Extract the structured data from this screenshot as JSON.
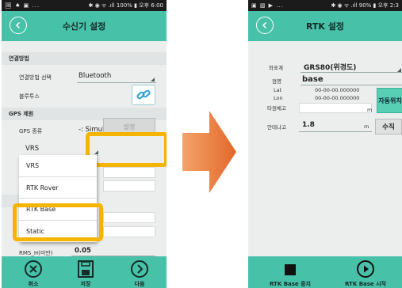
{
  "left": {
    "status": {
      "left_icons": "🖼 ♠ ▣ ...",
      "right": "✱ ◉ ᯤ .ıll 100% ▮ 오후 6:00"
    },
    "title": "수신기 설정",
    "sections": {
      "connection": "연결방법",
      "gps": "GPS 제원"
    },
    "rows": {
      "connection_method_label": "연결방법 선택",
      "connection_method_value": "Bluetooth",
      "bluetooth_label": "블루투스",
      "gps_type_label": "GPS 종류",
      "gps_type_value": "-: Simulation",
      "mode_value": "VRS",
      "rms_label": "RMS_H(미만)",
      "rms_value": "0.05"
    },
    "settings_button": "설정",
    "dropdown": [
      "VRS",
      "RTK Rover",
      "RTK Base",
      "Static"
    ],
    "bottom": {
      "cancel": "취소",
      "save": "저장",
      "next": "다음"
    }
  },
  "right": {
    "status": {
      "left_icons": "▣ ▧ ▶ ...",
      "right": "✱ ◉ ᯤ .ıll 90% ▮ 오후 2:3"
    },
    "title": "RTK 설정",
    "coord_label": "좌표계",
    "coord_value": "GRS80(위경도)",
    "point_label": "점명",
    "point_value": "base",
    "lat_label": "Lat",
    "lat_value": "00-00-00.000000",
    "lon_label": "Lon",
    "lon_value": "00-00-00.000000",
    "ellipsoid_label": "타원체고",
    "ellipsoid_unit": "m",
    "auto_position_button": "자동위치",
    "antenna_label": "안테나고",
    "antenna_value": "1.8",
    "antenna_unit": "m",
    "manual_button": "수직",
    "bottom": {
      "stop": "RTK Base 중지",
      "start": "RTK Base 시작"
    }
  }
}
